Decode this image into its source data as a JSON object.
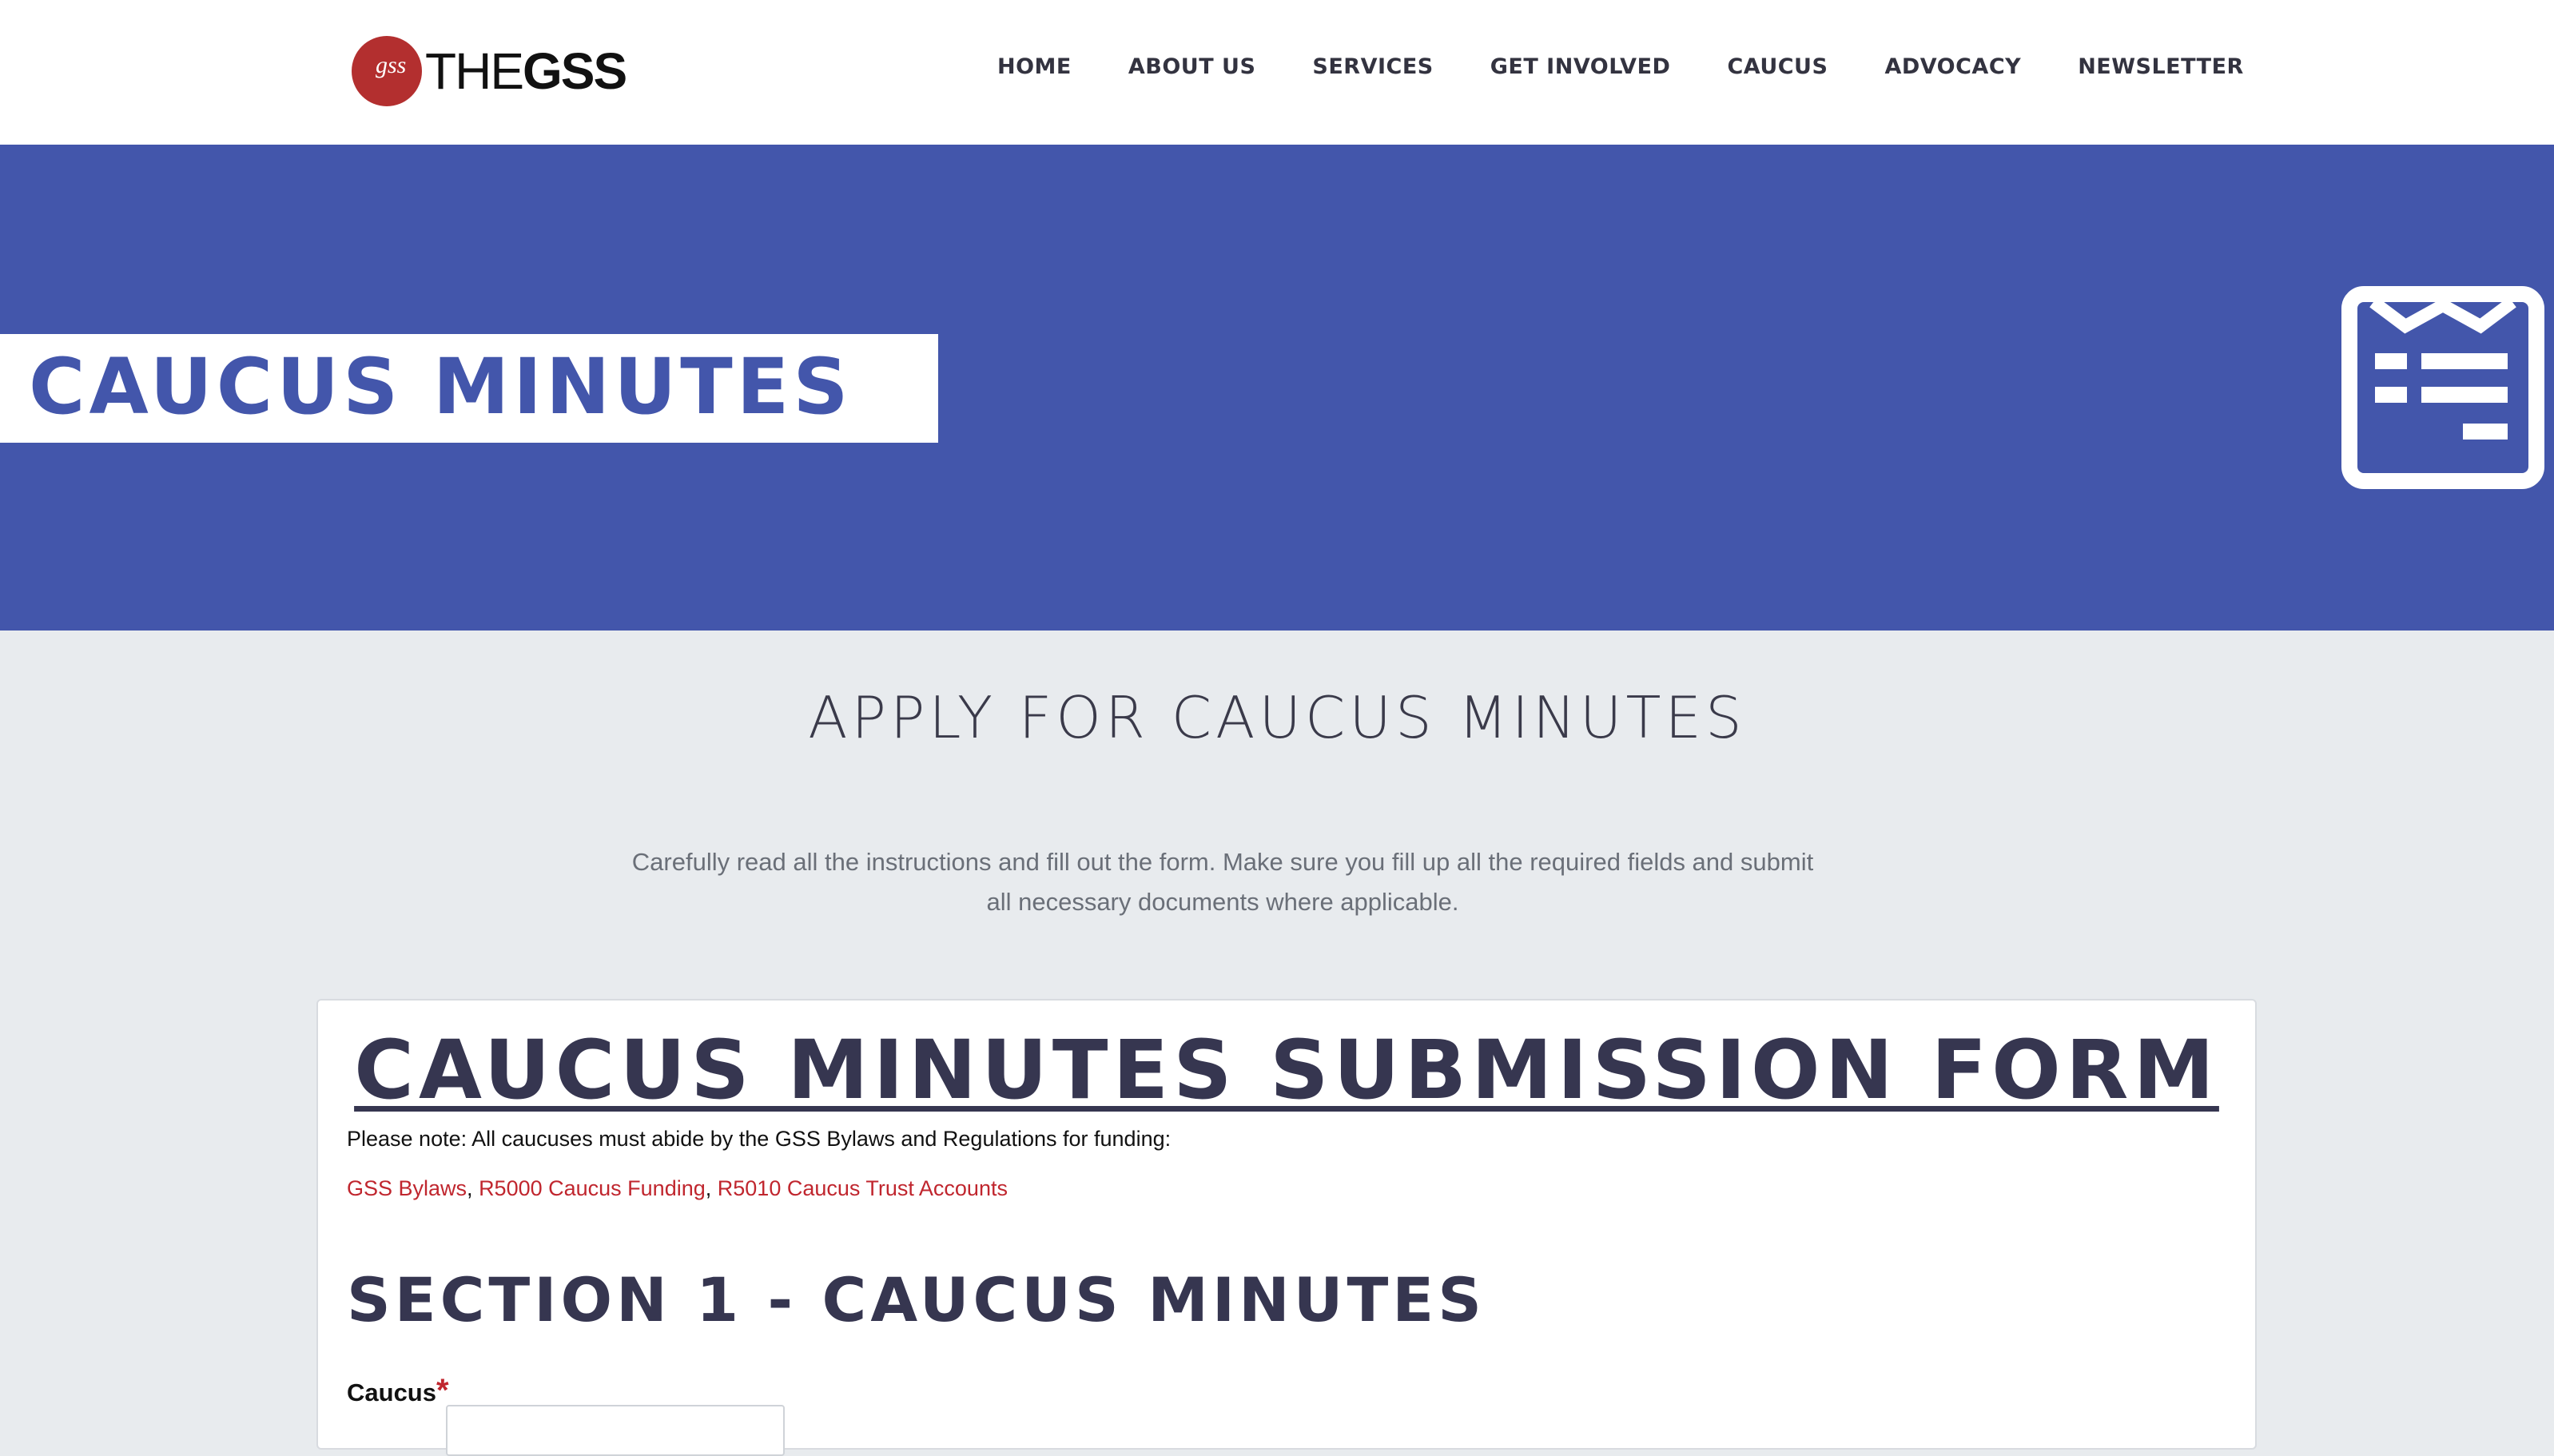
{
  "header": {
    "logo_initials": "gss",
    "logo_text_thin": "THE",
    "logo_text_bold": "GSS",
    "nav": [
      "HOME",
      "ABOUT US",
      "SERVICES",
      "GET INVOLVED",
      "CAUCUS",
      "ADVOCACY",
      "NEWSLETTER"
    ]
  },
  "hero": {
    "title": "CAUCUS MINUTES",
    "icon": "form-document-icon"
  },
  "intro": {
    "title": "APPLY FOR CAUCUS MINUTES",
    "text_line1": "Carefully read all the instructions and fill out the form. Make sure you fill up all the required fields and submit",
    "text_line2": "all necessary documents where applicable."
  },
  "form": {
    "title": "CAUCUS MINUTES SUBMISSION FORM",
    "note": "Please note: All caucuses must abide by the GSS Bylaws and Regulations for funding:",
    "links": [
      "GSS Bylaws",
      "R5000 Caucus Funding",
      "R5010 Caucus Trust Accounts"
    ],
    "link_separator": ", ",
    "section_title": "SECTION 1 - CAUCUS MINUTES",
    "caucus_label": "Caucus",
    "required_mark": "*",
    "caucus_value": ""
  },
  "colors": {
    "hero_bg": "#4356ab",
    "page_bg": "#e8ebee",
    "link": "#c0262e",
    "heading": "#363650",
    "logo": "#b32f2f"
  }
}
